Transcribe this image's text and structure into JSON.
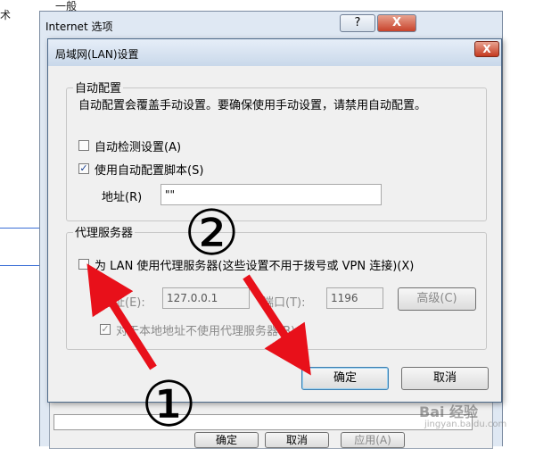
{
  "background": {
    "text_left": "术",
    "text_top": "一般"
  },
  "outer_window": {
    "title": "Internet 选项",
    "help": "?",
    "close": "X",
    "buttons": {
      "ok": "确定",
      "cancel": "取消",
      "apply": "应用(A)"
    }
  },
  "lan_dialog": {
    "title": "局域网(LAN)设置",
    "close": "X",
    "auto_config": {
      "group_title": "自动配置",
      "description": "自动配置会覆盖手动设置。要确保使用手动设置，请禁用自动配置。",
      "auto_detect_label": "自动检测设置(A)",
      "auto_detect_checked": false,
      "use_script_label": "使用自动配置脚本(S)",
      "use_script_checked": true,
      "address_label": "地址(R)",
      "address_value": "\"\""
    },
    "proxy": {
      "group_title": "代理服务器",
      "use_proxy_label": "为 LAN 使用代理服务器(这些设置不用于拨号或 VPN 连接)(X)",
      "use_proxy_checked": false,
      "address_label": "地址(E):",
      "address_value": "127.0.0.1",
      "port_label": "端口(T):",
      "port_value": "1196",
      "advanced_label": "高级(C)",
      "bypass_label": "对于本地地址不使用代理服务器(B)",
      "bypass_checked": true
    },
    "ok": "确定",
    "cancel": "取消"
  },
  "annotations": {
    "step1": "①",
    "step2": "②",
    "arrow_color": "#e8101a"
  },
  "watermark": {
    "text": "Bai 经验",
    "sub": "jingyan.baidu.com"
  }
}
